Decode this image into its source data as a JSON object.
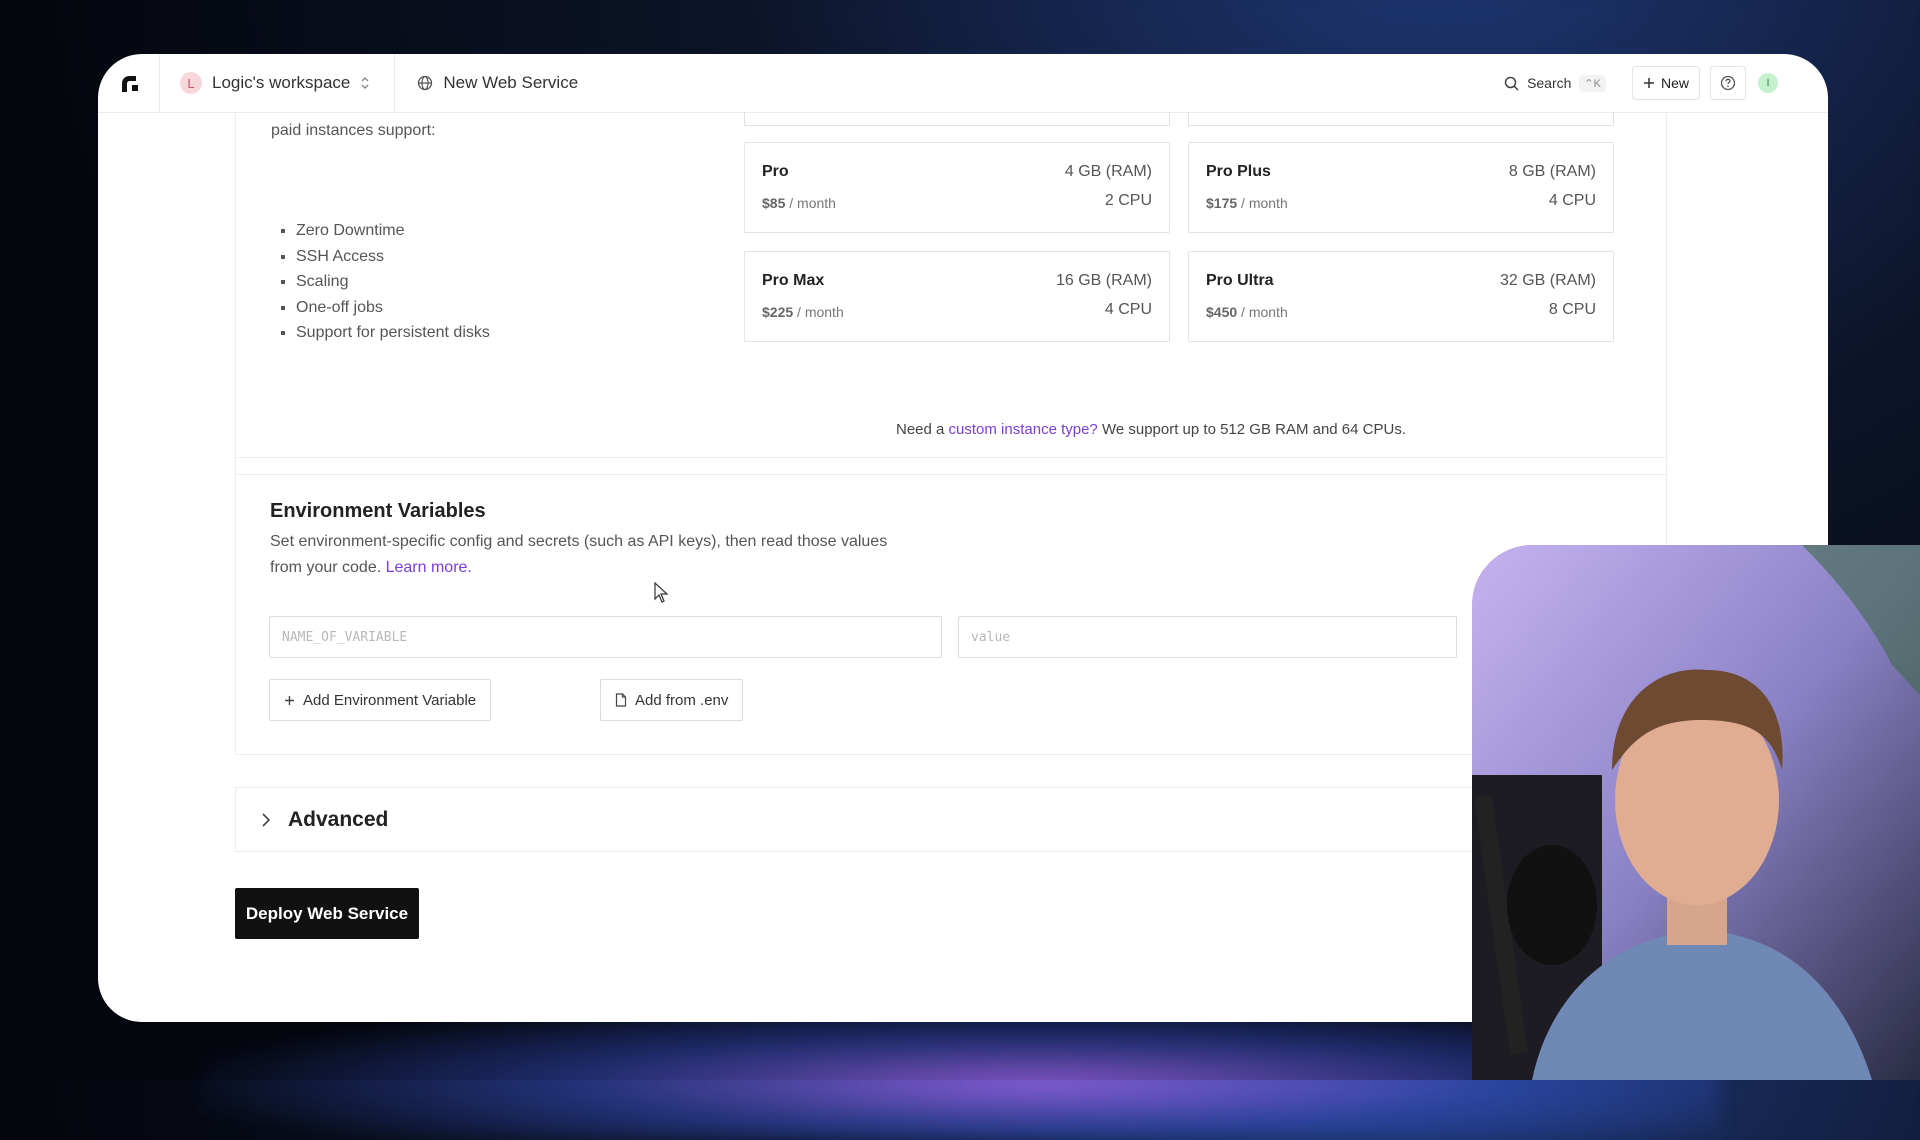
{
  "topbar": {
    "workspace_initial": "L",
    "workspace_name": "Logic's workspace",
    "breadcrumb": "New Web Service",
    "search_label": "Search",
    "search_shortcut": "⌃K",
    "new_label": "New",
    "user_initial": "I"
  },
  "instances": {
    "paid_text": "paid instances support:",
    "features": [
      "Zero Downtime",
      "SSH Access",
      "Scaling",
      "One-off jobs",
      "Support for persistent disks"
    ],
    "plans": [
      {
        "name": "Pro",
        "ram": "4 GB (RAM)",
        "price": "$85",
        "period": "/ month",
        "cpu": "2 CPU"
      },
      {
        "name": "Pro Plus",
        "ram": "8 GB (RAM)",
        "price": "$175",
        "period": "/ month",
        "cpu": "4 CPU"
      },
      {
        "name": "Pro Max",
        "ram": "16 GB (RAM)",
        "price": "$225",
        "period": "/ month",
        "cpu": "4 CPU"
      },
      {
        "name": "Pro Ultra",
        "ram": "32 GB (RAM)",
        "price": "$450",
        "period": "/ month",
        "cpu": "8 CPU"
      }
    ],
    "need_prefix": "Need a",
    "need_link": "custom instance type?",
    "need_suffix": "We support up to 512 GB RAM and 64 CPUs."
  },
  "env": {
    "title": "Environment Variables",
    "desc": "Set environment-specific config and secrets (such as API keys), then read those values from your code.",
    "learn_more": "Learn more.",
    "name_placeholder": "NAME_OF_VARIABLE",
    "value_placeholder": "value",
    "add_var_label": "Add Environment Variable",
    "add_env_label": "Add from .env"
  },
  "advanced": {
    "label": "Advanced"
  },
  "deploy": {
    "label": "Deploy Web Service"
  },
  "colors": {
    "accent_link": "#7a3ed6",
    "deploy_bg": "#111111"
  }
}
